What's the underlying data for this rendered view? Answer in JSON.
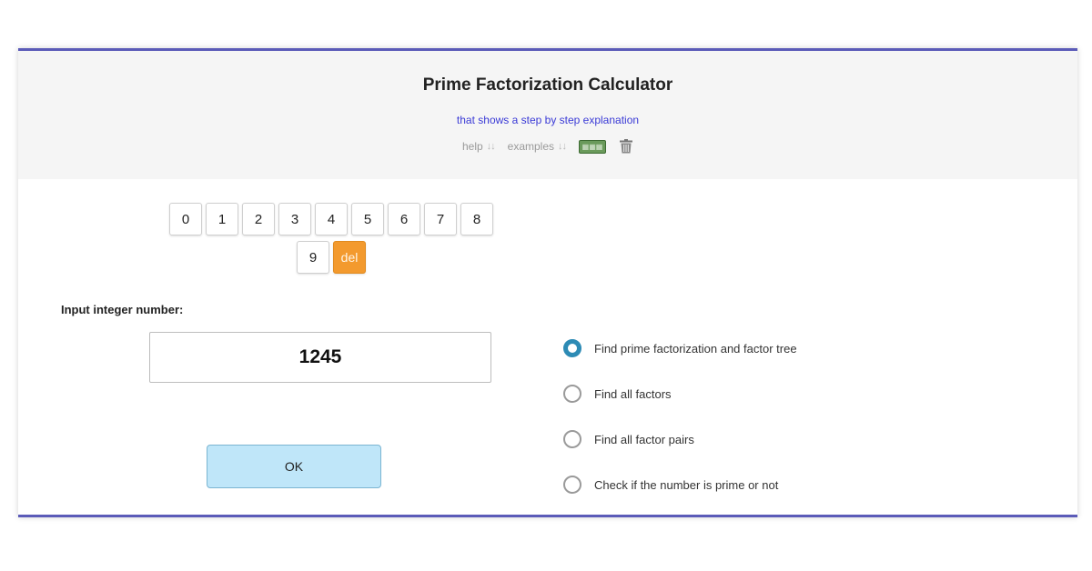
{
  "header": {
    "title": "Prime Factorization Calculator",
    "subtitle": "that shows a step by step explanation",
    "help_label": "help",
    "examples_label": "examples",
    "arrows": "↓↓",
    "lang_icon": "keyboard-icon",
    "trash_icon": "trash-icon"
  },
  "keypad": {
    "row1": [
      "0",
      "1",
      "2",
      "3",
      "4",
      "5",
      "6",
      "7",
      "8"
    ],
    "row2": [
      "9"
    ],
    "delete_label": "del"
  },
  "input": {
    "label": "Input integer number:",
    "value": "1245"
  },
  "ok_label": "OK",
  "options": [
    {
      "label": "Find prime factorization and factor tree",
      "checked": true
    },
    {
      "label": "Find all factors",
      "checked": false
    },
    {
      "label": "Find all factor pairs",
      "checked": false
    },
    {
      "label": "Check if the number is prime or not",
      "checked": false
    }
  ],
  "colors": {
    "frame_border": "#5b5bb8",
    "subtitle": "#3a3ad6",
    "delete_key": "#f39a2e",
    "ok_button": "#bfe6f9",
    "radio_checked": "#2d8bb5"
  }
}
